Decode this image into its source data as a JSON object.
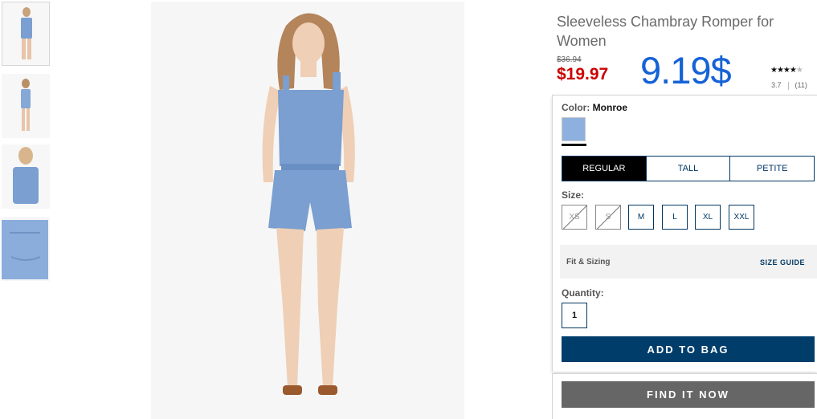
{
  "product": {
    "title": "Sleeveless Chambray Romper for Women",
    "price_original": "$36.94",
    "price_sale": "$19.97",
    "price_overlay": "9.19$",
    "rating_stars": "★★★★",
    "rating_stars_empty": "★",
    "rating_value": "3.7",
    "rating_count": "(11)"
  },
  "color": {
    "label": "Color:",
    "value": "Monroe",
    "swatch_hex": "#8db0de"
  },
  "fit_tabs": [
    "REGULAR",
    "TALL",
    "PETITE"
  ],
  "size": {
    "label": "Size:",
    "options": [
      "XS",
      "S",
      "M",
      "L",
      "XL",
      "XXL"
    ],
    "unavailable": [
      "XS",
      "S"
    ]
  },
  "fit_sizing": {
    "label": "Fit & Sizing",
    "guide": "SIZE GUIDE"
  },
  "quantity": {
    "label": "Quantity:",
    "value": "1"
  },
  "buttons": {
    "add_to_bag": "ADD TO BAG",
    "find_it_now": "FIND IT NOW"
  },
  "colors": {
    "navy": "#003764",
    "sale_red": "#cc0000",
    "overlay_blue": "#1562d6",
    "chambray": "#7a9fd0"
  }
}
